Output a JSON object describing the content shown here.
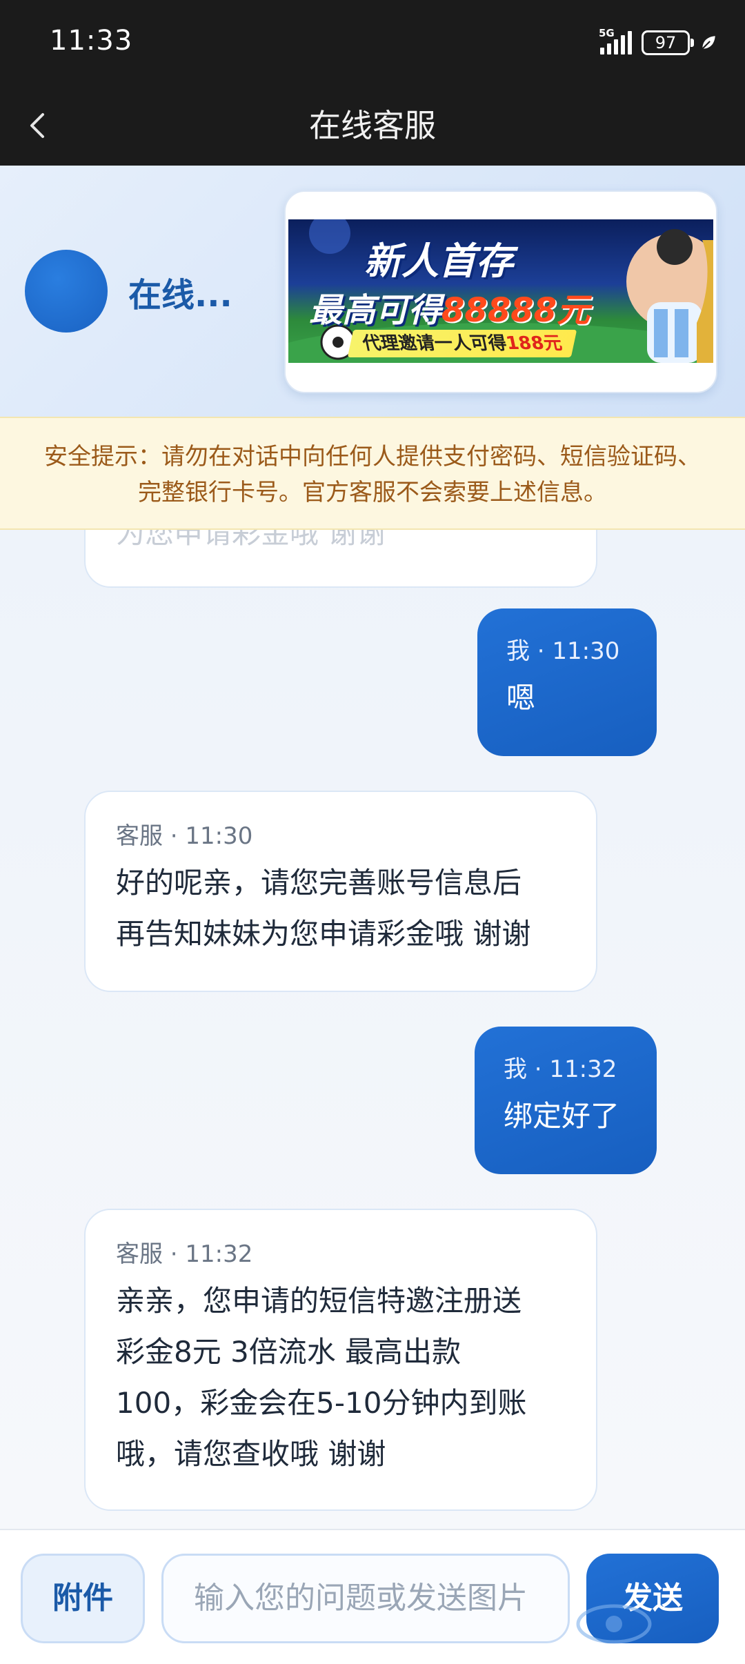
{
  "status_bar": {
    "time": "11:33",
    "network": "5G",
    "battery": "97"
  },
  "header": {
    "title": "在线客服",
    "back_icon": "chevron-left-icon"
  },
  "agent": {
    "name": "在线...",
    "avatar_color": "#1a62c2"
  },
  "banner": {
    "title": "新人首存",
    "subtitle_prefix": "最高可得",
    "amount": "88888元",
    "strip_text": "代理邀请一人可得",
    "strip_amount": "188元"
  },
  "notice": {
    "text": "安全提示：请勿在对话中向任何人提供支付密码、短信验证码、完整银行卡号。官方客服不会索要上述信息。"
  },
  "messages": [
    {
      "from": "agent",
      "meta": "",
      "text": "为您申请彩金哦 谢谢"
    },
    {
      "from": "me",
      "meta": "我 · 11:30",
      "text": "嗯"
    },
    {
      "from": "agent",
      "meta": "客服 · 11:30",
      "lines": [
        "好的呢亲，请您完善账号信息后",
        "再告知妹妹为您申请彩金哦 谢谢"
      ]
    },
    {
      "from": "me",
      "meta": "我 · 11:32",
      "text": "绑定好了"
    },
    {
      "from": "agent",
      "meta": "客服 · 11:32",
      "lines": [
        "亲亲，您申请的短信特邀注册送",
        "彩金8元 3倍流水 最高出款",
        "100，彩金会在5-10分钟内到账",
        "哦，请您查收哦 谢谢"
      ]
    }
  ],
  "input": {
    "attach_label": "附件",
    "placeholder": "输入您的问题或发送图片",
    "send_label": "发送"
  },
  "colors": {
    "accent": "#1a62c2",
    "notice_text": "#9b5a1a",
    "notice_bg": "#fdf7e0"
  }
}
